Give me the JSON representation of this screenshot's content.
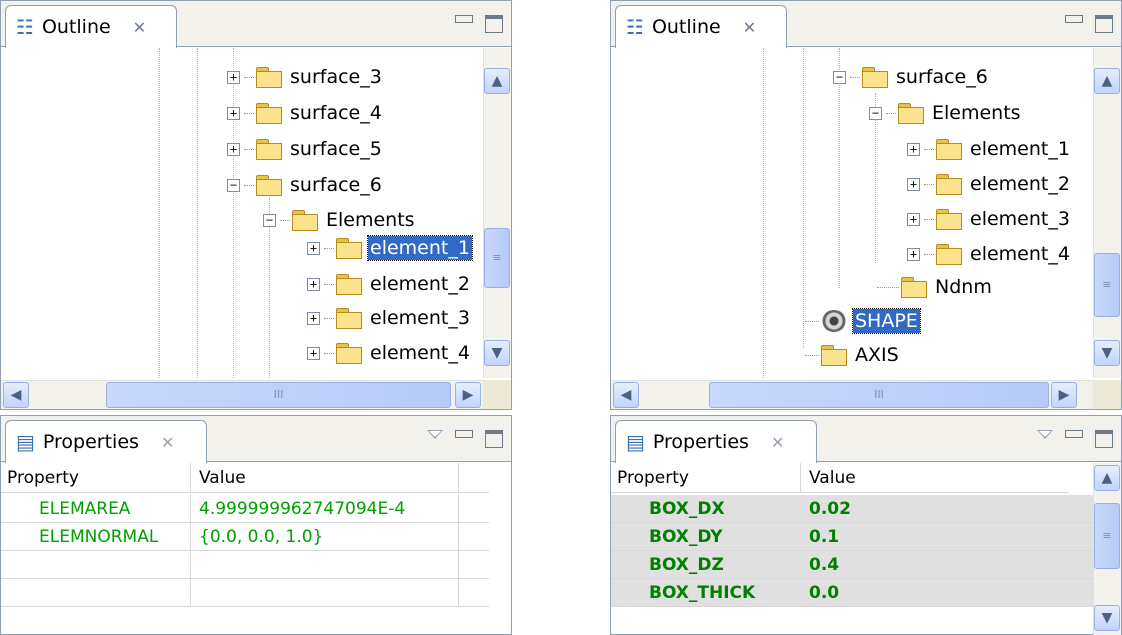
{
  "left_panel": {
    "outline": {
      "tab_label": "Outline",
      "tree": [
        {
          "label": "surface_3",
          "expander": "+"
        },
        {
          "label": "surface_4",
          "expander": "+"
        },
        {
          "label": "surface_5",
          "expander": "+"
        },
        {
          "label": "surface_6",
          "expander": "−"
        },
        {
          "label": "Elements",
          "expander": "−"
        },
        {
          "label": "element_1",
          "expander": "+",
          "selected": true
        },
        {
          "label": "element_2",
          "expander": "+"
        },
        {
          "label": "element_3",
          "expander": "+"
        },
        {
          "label": "element_4",
          "expander": "+"
        }
      ],
      "hscroll_grip": "III",
      "vscroll_grip": "≡"
    },
    "properties": {
      "tab_label": "Properties",
      "columns": [
        "Property",
        "Value"
      ],
      "rows": [
        {
          "property": "ELEMAREA",
          "value": "4.999999962747094E-4"
        },
        {
          "property": "ELEMNORMAL",
          "value": "{0.0, 0.0, 1.0}"
        }
      ]
    }
  },
  "right_panel": {
    "outline": {
      "tab_label": "Outline",
      "tree": [
        {
          "label": "surface_6",
          "expander": "−"
        },
        {
          "label": "Elements",
          "expander": "−"
        },
        {
          "label": "element_1",
          "expander": "+"
        },
        {
          "label": "element_2",
          "expander": "+"
        },
        {
          "label": "element_3",
          "expander": "+"
        },
        {
          "label": "element_4",
          "expander": "+"
        },
        {
          "label": "Ndnm"
        },
        {
          "label": "SHAPE",
          "selected": true,
          "icon": "shape-icon"
        },
        {
          "label": "AXIS"
        }
      ],
      "hscroll_grip": "III",
      "vscroll_grip": "≡"
    },
    "properties": {
      "tab_label": "Properties",
      "columns": [
        "Property",
        "Value"
      ],
      "rows": [
        {
          "property": "BOX_DX",
          "value": "0.02"
        },
        {
          "property": "BOX_DY",
          "value": "0.1"
        },
        {
          "property": "BOX_DZ",
          "value": "0.4"
        },
        {
          "property": "BOX_THICK",
          "value": "0.0"
        }
      ],
      "vscroll_grip": "≡"
    }
  },
  "colors": {
    "selection": "#316ac5",
    "value_green": "#00a000",
    "folder_yellow": "#fbe28c",
    "tab_border": "#8f9fb4"
  }
}
